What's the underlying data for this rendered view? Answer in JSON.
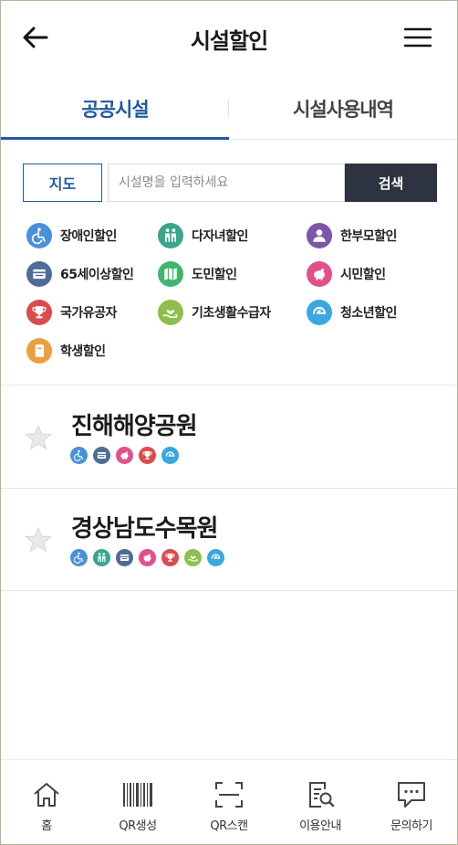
{
  "header": {
    "title": "시설할인"
  },
  "tabs": [
    {
      "label": "공공시설",
      "active": true
    },
    {
      "label": "시설사용내역",
      "active": false
    }
  ],
  "search": {
    "map_label": "지도",
    "placeholder": "시설명을 입력하세요",
    "value": "",
    "button_label": "검색"
  },
  "legend": [
    {
      "key": "disabled",
      "label": "장애인할인",
      "icon": "wheelchair-icon",
      "color": "#4a90d9"
    },
    {
      "key": "multichild",
      "label": "다자녀할인",
      "icon": "family-icon",
      "color": "#3aa58a"
    },
    {
      "key": "singleparent",
      "label": "한부모할인",
      "icon": "person-icon",
      "color": "#7b55a8"
    },
    {
      "key": "senior",
      "label": "65세이상할인",
      "icon": "card-icon",
      "color": "#4f6c96"
    },
    {
      "key": "province",
      "label": "도민할인",
      "icon": "map-icon",
      "color": "#3fb56e"
    },
    {
      "key": "citizen",
      "label": "시민할인",
      "icon": "piggybank-icon",
      "color": "#e2508a"
    },
    {
      "key": "patriot",
      "label": "국가유공자",
      "icon": "trophy-icon",
      "color": "#dc4b4b"
    },
    {
      "key": "welfare",
      "label": "기초생활수급자",
      "icon": "heart-hand-icon",
      "color": "#8cc04a"
    },
    {
      "key": "youth",
      "label": "청소년할인",
      "icon": "swirl-icon",
      "color": "#3aa7e0"
    },
    {
      "key": "student",
      "label": "학생할인",
      "icon": "notebook-icon",
      "color": "#eba040"
    }
  ],
  "facilities": [
    {
      "name": "진해해양공원",
      "favorite": false,
      "badges": [
        "disabled",
        "senior",
        "citizen",
        "patriot",
        "youth"
      ]
    },
    {
      "name": "경상남도수목원",
      "favorite": false,
      "badges": [
        "disabled",
        "multichild",
        "senior",
        "citizen",
        "patriot",
        "welfare",
        "youth"
      ]
    }
  ],
  "bottom_nav": [
    {
      "label": "홈",
      "icon": "home-icon"
    },
    {
      "label": "QR생성",
      "icon": "barcode-icon"
    },
    {
      "label": "QR스캔",
      "icon": "scan-icon"
    },
    {
      "label": "이용안내",
      "icon": "guide-icon"
    },
    {
      "label": "문의하기",
      "icon": "chat-icon"
    }
  ]
}
